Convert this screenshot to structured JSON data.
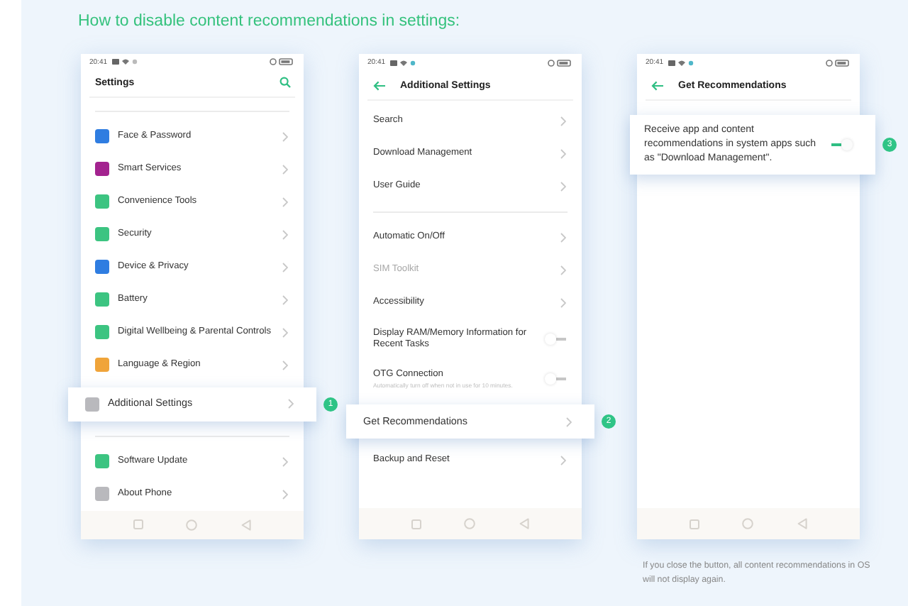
{
  "title": "How to disable content recommendations in settings:",
  "phones": [
    {
      "status_time": "20:41",
      "header": {
        "kind": "root",
        "title": "Settings"
      },
      "rows": [
        {
          "kind": "link",
          "label": "Face & Password",
          "color": "#2f7de1",
          "highlighted": false,
          "gap_before": true
        },
        {
          "kind": "link",
          "label": "Smart Services",
          "color": "#a3238f",
          "highlighted": false,
          "gap_before": false
        },
        {
          "kind": "link",
          "label": "Convenience Tools",
          "color": "#3cc481",
          "highlighted": false,
          "gap_before": false
        },
        {
          "kind": "link",
          "label": "Security",
          "color": "#3cc481",
          "highlighted": false,
          "gap_before": false
        },
        {
          "kind": "link",
          "label": "Device & Privacy",
          "color": "#2f7de1",
          "highlighted": false,
          "gap_before": false
        },
        {
          "kind": "link",
          "label": "Battery",
          "color": "#3cc481",
          "highlighted": false,
          "gap_before": false
        },
        {
          "kind": "link",
          "label": "Digital Wellbeing & Parental Controls",
          "color": "#3cc481",
          "highlighted": false,
          "gap_before": false
        },
        {
          "kind": "link",
          "label": "Language & Region",
          "color": "#f0a43a",
          "highlighted": false,
          "gap_before": false
        },
        {
          "kind": "link",
          "label": "Additional Settings",
          "color": "#b9b9bd",
          "highlighted": true,
          "badge": "1",
          "gap_before": false
        },
        {
          "kind": "link",
          "label": "Software Update",
          "color": "#3cc481",
          "highlighted": false,
          "gap_before": true
        },
        {
          "kind": "link",
          "label": "About Phone",
          "color": "#b9b9bd",
          "highlighted": false,
          "gap_before": false
        }
      ]
    },
    {
      "status_time": "20:41",
      "header": {
        "kind": "sub",
        "title": "Additional Settings"
      },
      "rows": [
        {
          "kind": "link",
          "label": "Search",
          "highlighted": false,
          "disabled": false,
          "gap_before": false
        },
        {
          "kind": "link",
          "label": "Download Management",
          "highlighted": false,
          "disabled": false,
          "gap_before": false
        },
        {
          "kind": "link",
          "label": "User Guide",
          "highlighted": false,
          "disabled": false,
          "gap_before": false
        },
        {
          "kind": "link",
          "label": "Automatic On/Off",
          "highlighted": false,
          "disabled": false,
          "gap_before": true
        },
        {
          "kind": "link",
          "label": "SIM Toolkit",
          "highlighted": false,
          "disabled": true,
          "gap_before": false
        },
        {
          "kind": "link",
          "label": "Accessibility",
          "highlighted": false,
          "disabled": false,
          "gap_before": false
        },
        {
          "kind": "toggle",
          "label": "Display RAM/Memory Information for Recent Tasks",
          "on": false,
          "highlighted": false,
          "gap_before": false
        },
        {
          "kind": "toggle",
          "label": "OTG Connection",
          "subtitle": "Automatically turn off when not in use for 10 minutes.",
          "on": false,
          "highlighted": false,
          "gap_before": false
        },
        {
          "kind": "link",
          "label": "Get Recommendations",
          "highlighted": true,
          "badge": "2",
          "disabled": false,
          "gap_before": false
        },
        {
          "kind": "link",
          "label": "Backup and Reset",
          "highlighted": false,
          "disabled": false,
          "gap_before": false
        }
      ]
    },
    {
      "status_time": "20:41",
      "header": {
        "kind": "sub",
        "title": "Get Recommendations"
      },
      "rows": [
        {
          "kind": "card-toggle",
          "label": "Receive app and content recommendations in system apps such as \"Download Management\".",
          "on": true,
          "highlighted": true,
          "badge": "3",
          "gap_before": false
        }
      ],
      "note": "If you close the button, all content recommendations in OS will not display again."
    }
  ]
}
